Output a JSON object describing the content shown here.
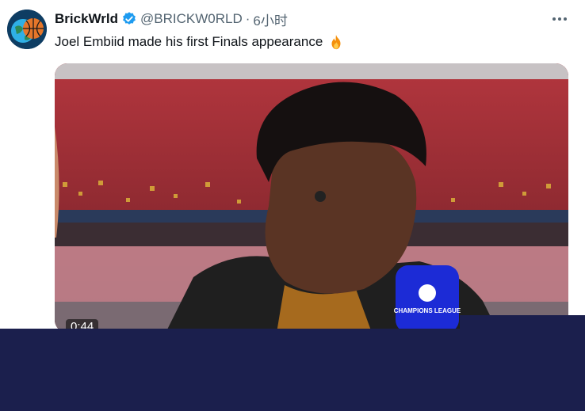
{
  "author": {
    "name": "BrickWrld",
    "handle": "@BRICKW0RLD",
    "separator": "·",
    "time": "6小时",
    "verified": true,
    "avatar_icon": "basketball-globe-avatar"
  },
  "tweet": {
    "text": "Joel Embiid made his first Finals appearance",
    "emoji": "fire-emoji"
  },
  "media": {
    "type": "video",
    "duration": "0:44",
    "mic_badge_text": "CHAMPIONS LEAGUE"
  },
  "colors": {
    "verified_blue": "#1d9bf0",
    "overlay_navy": "#1b1f4d",
    "stadium_red": "#a12a33",
    "mic_blue": "#1c2bd6"
  }
}
